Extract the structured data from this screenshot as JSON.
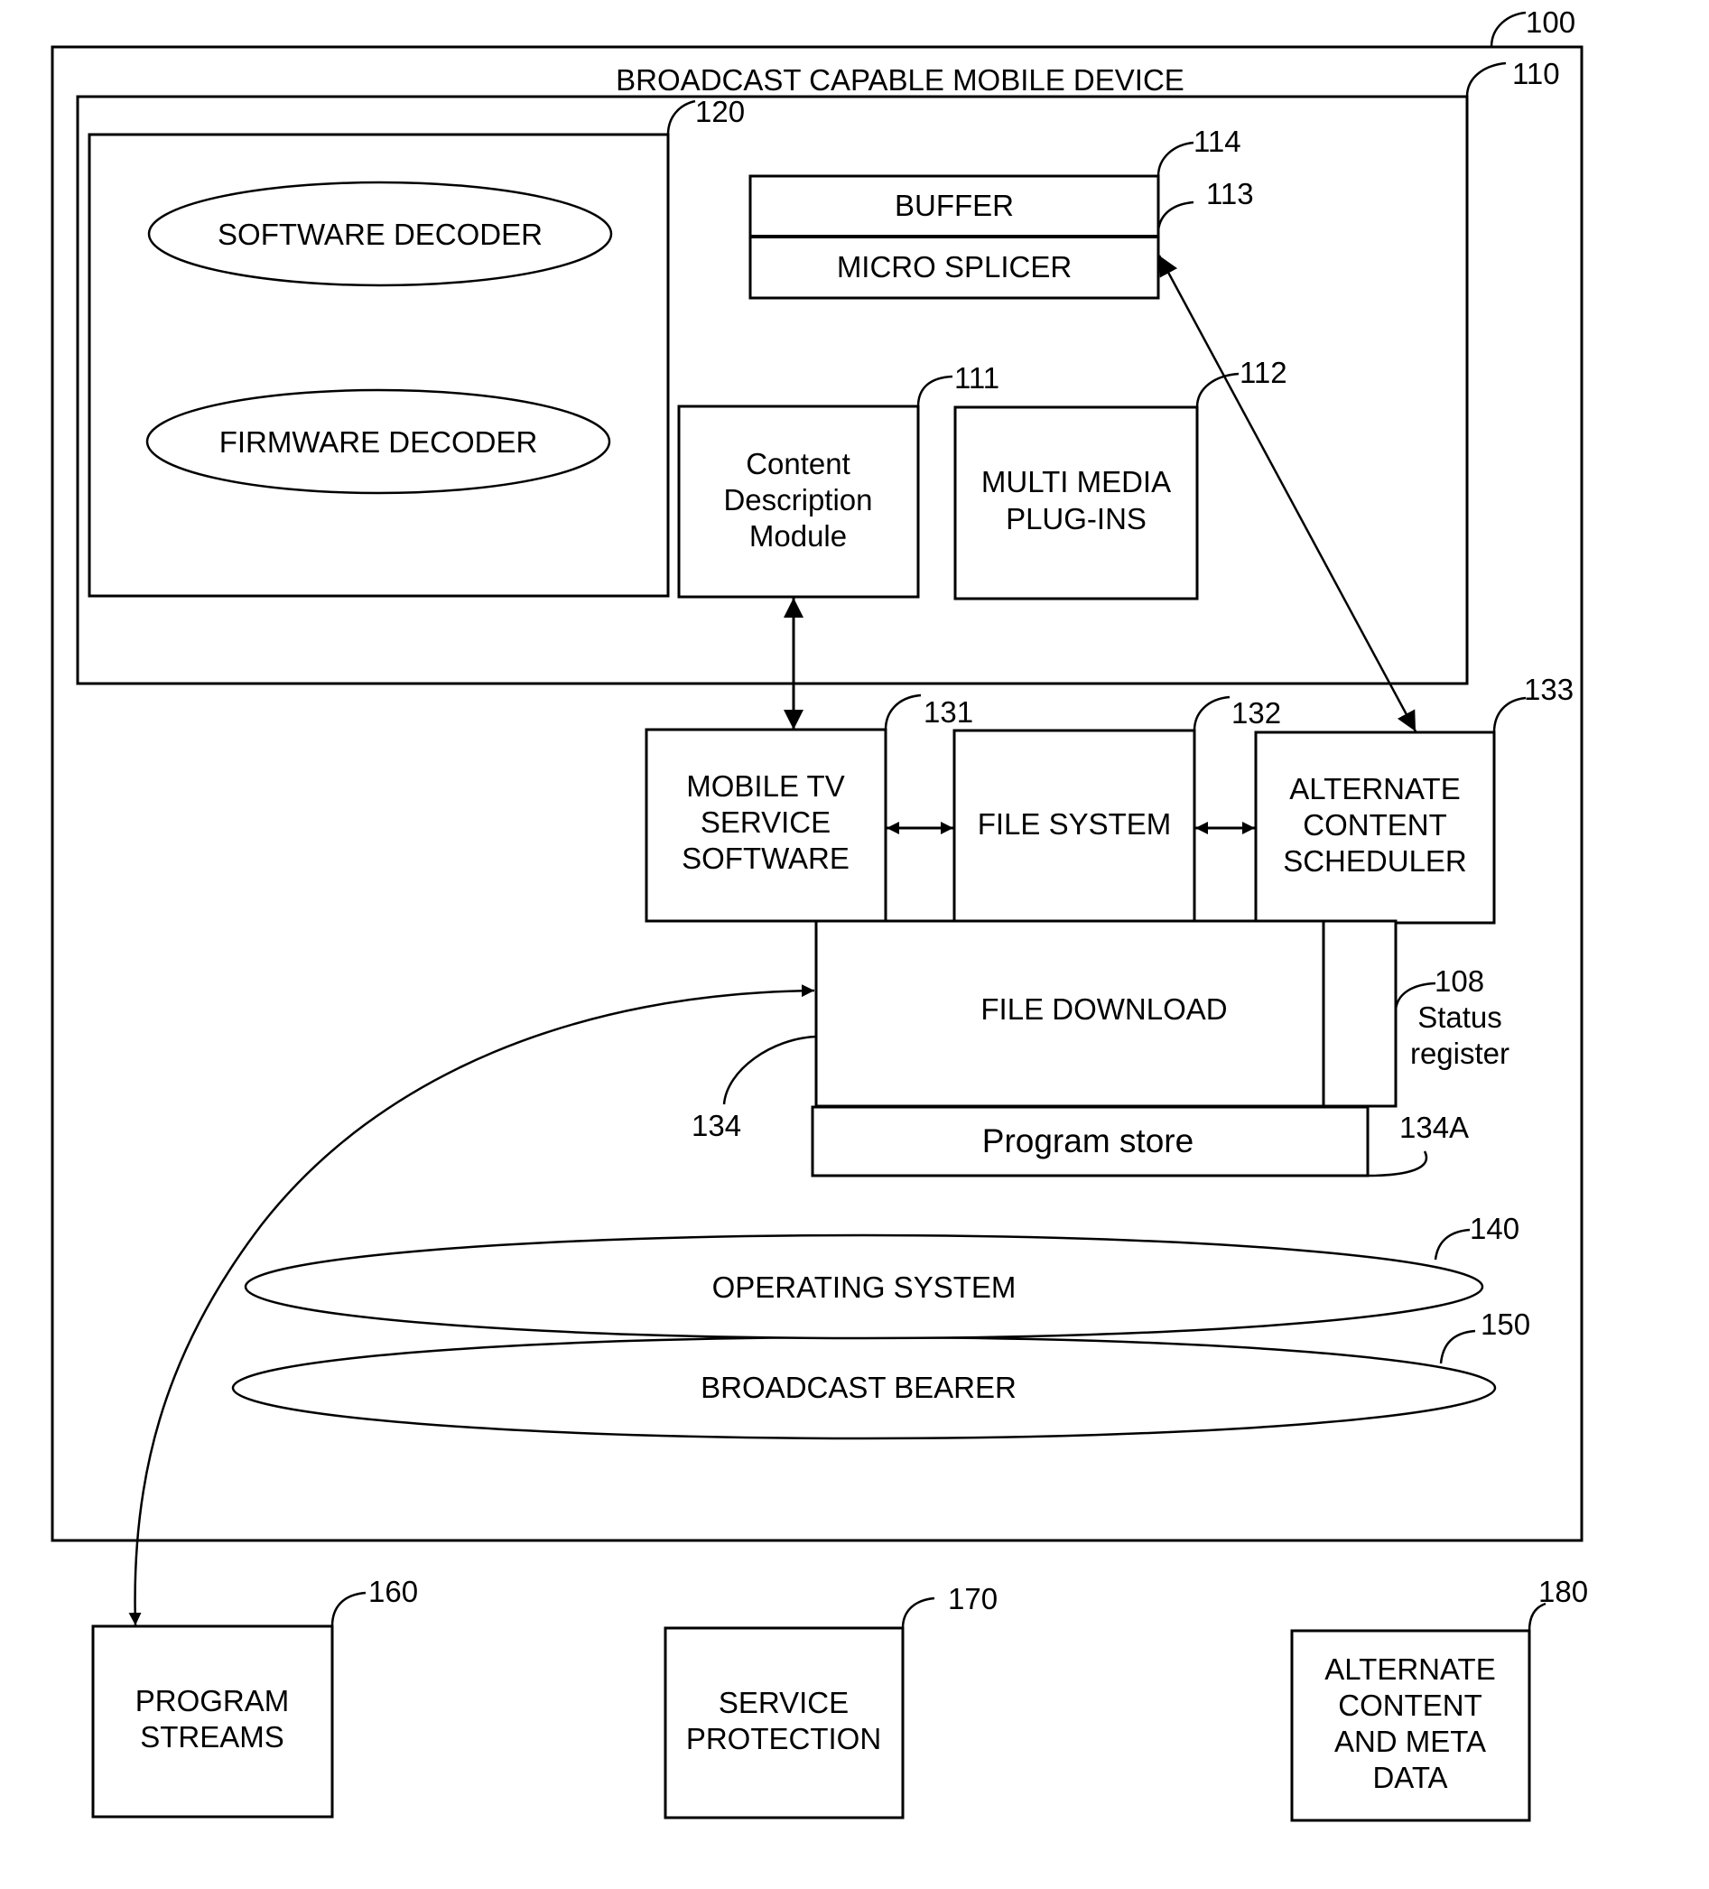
{
  "figure": {
    "title": "BROADCAST CAPABLE MOBILE DEVICE",
    "refs": {
      "outer": "100",
      "device": "110",
      "decoder_group": "120",
      "buffer": "114",
      "micro_splicer": "113",
      "content_description": "111",
      "multimedia_plugins": "112",
      "mobile_tv": "131",
      "file_system": "132",
      "alt_scheduler": "133",
      "file_download": "134",
      "program_store": "134A",
      "status_register": "108",
      "operating_system": "140",
      "broadcast_bearer": "150",
      "program_streams": "160",
      "service_protection": "170",
      "alt_content_meta": "180"
    },
    "decoders": {
      "software": "SOFTWARE DECODER",
      "firmware": "FIRMWARE DECODER"
    },
    "buffer": "BUFFER",
    "micro_splicer": "MICRO SPLICER",
    "content_description": [
      "Content",
      "Description",
      "Module"
    ],
    "multimedia_plugins": [
      "MULTI MEDIA",
      "PLUG-INS"
    ],
    "mobile_tv": [
      "MOBILE TV",
      "SERVICE",
      "SOFTWARE"
    ],
    "file_system": "FILE SYSTEM",
    "alt_scheduler": [
      "ALTERNATE",
      "CONTENT",
      "SCHEDULER"
    ],
    "file_download": "FILE DOWNLOAD",
    "status_register": [
      "Status",
      "register"
    ],
    "program_store": "Program store",
    "operating_system": "OPERATING SYSTEM",
    "broadcast_bearer": "BROADCAST BEARER",
    "program_streams": [
      "PROGRAM",
      "STREAMS"
    ],
    "service_protection": [
      "SERVICE",
      "PROTECTION"
    ],
    "alt_content_meta": [
      "ALTERNATE",
      "CONTENT",
      "AND META",
      "DATA"
    ]
  }
}
